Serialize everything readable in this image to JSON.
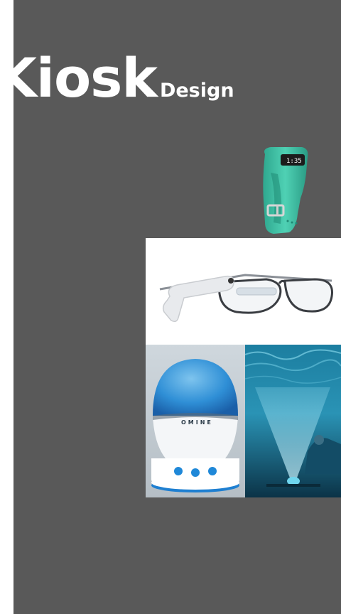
{
  "slide": {
    "title_main": "Kiosk",
    "title_sub": "Design",
    "background_color": "#595959",
    "text_color": "#ffffff"
  },
  "images": {
    "fitbit": {
      "icon": "fitness-tracker-icon",
      "display_text": "1:35"
    },
    "glasses": {
      "icon": "smart-glasses-icon"
    },
    "projector_lamp": {
      "icon": "ocean-projector-lamp-icon",
      "brand": "OMINE"
    },
    "projection_room": {
      "icon": "projection-room-photo"
    }
  }
}
